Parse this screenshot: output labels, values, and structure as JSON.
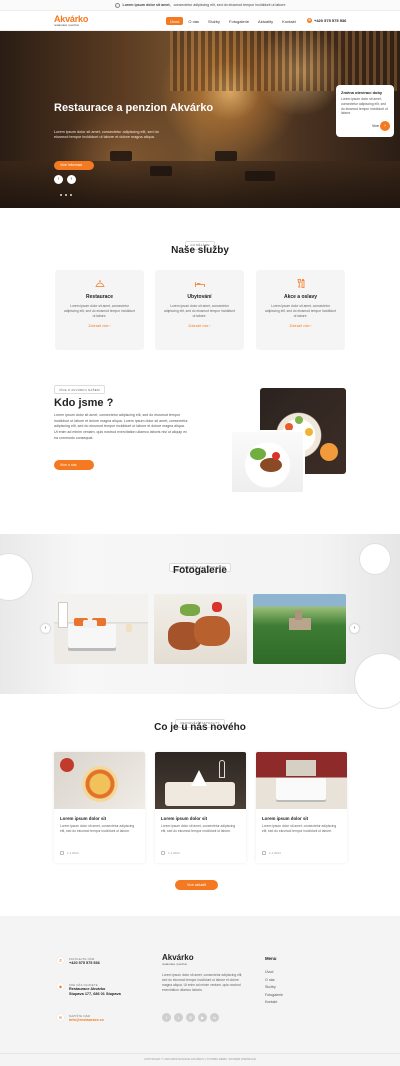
{
  "topbar": {
    "bold": "Lorem ipsum dolor sit amet,",
    "text": "consectetur adipiscing elit, sed do eiusmod tempor incididunt ut labore"
  },
  "nav": {
    "logo_name": "Akvárko",
    "logo_sub": "restaurace i penzion",
    "items": [
      "Úvod",
      "O nás",
      "Služby",
      "Fotogalerie",
      "Aktuality",
      "Kontakt"
    ],
    "phone": "+420 575 575 536"
  },
  "hero": {
    "title": "Restaurace a penzion Akvárko",
    "text": "Lorem ipsum dolor sit amet, consectetur adipiscing elit, sed do eiusmod tempor incididunt ut labore et dolore magna aliqua.",
    "button": "Více informací",
    "card": {
      "title": "Změna otevírací doby",
      "text": "Lorem ipsum dolor sit amet, consectetur adipiscing elit, sed do eiusmod tempor incididunt ut labore.",
      "more": "Více"
    }
  },
  "services": {
    "badge": "CO DĚLÁME",
    "title": "Naše služby",
    "items": [
      {
        "title": "Restaurace",
        "text": "Lorem ipsum dolor sit amet, consectetur adipiscing elit, sed do eiusmod tempor incididunt ut labore.",
        "link": "Zobrazit více"
      },
      {
        "title": "Ubytování",
        "text": "Lorem ipsum dolor sit amet, consectetur adipiscing elit, sed do eiusmod tempor incididunt ut labore.",
        "link": "Zobrazit více"
      },
      {
        "title": "Akce a oslavy",
        "text": "Lorem ipsum dolor sit amet, consectetur adipiscing elit, sed do eiusmod tempor incididunt ut labore.",
        "link": "Zobrazit více"
      }
    ]
  },
  "about": {
    "badge": "VÍCE O AKVÁRKU NAŠEM",
    "title": "Kdo jsme ?",
    "text": "Lorem ipsum dolor sit amet, consectetur adipiscing elit, sed do eiusmod tempor incididunt ut labore et dolore magna aliqua. Lorem ipsum dolor sit amet, consectetur adipiscing elit, sed do eiusmod tempor incididunt ut labore et dolore magna aliqua. Ut enim ad minim veniam, quis nostrud exercitation ullamco laboris nisi ut aliquip ex ea commodo consequat.",
    "button": "Více o nás"
  },
  "gallery": {
    "badge": "PROHLÉDNĚTE SI FOTOGALERII",
    "title": "Fotogalerie"
  },
  "news": {
    "badge": "NEJNOVĚJŠÍ AKTUALITY",
    "title": "Co je u nás nového",
    "items": [
      {
        "title": "Lorem ipsum dolor sit",
        "text": "Lorem ipsum dolor sit amet, consectetur adipiscing elit, sed do eiusmod tempor incididunt ut labore.",
        "date": "1.1.2024"
      },
      {
        "title": "Lorem ipsum dolor sit",
        "text": "Lorem ipsum dolor sit amet, consectetur adipiscing elit, sed do eiusmod tempor incididunt ut labore.",
        "date": "1.1.2024"
      },
      {
        "title": "Lorem ipsum dolor sit",
        "text": "Lorem ipsum dolor sit amet, consectetur adipiscing elit, sed do eiusmod tempor incididunt ut labore.",
        "date": "1.1.2024"
      }
    ],
    "button": "Více aktualit"
  },
  "footer": {
    "contacts": [
      {
        "label": "ZAVOLEJTE NÁM",
        "value": "+420 575 575 536",
        "icon": "phone-icon"
      },
      {
        "label": "KDE NÁS NAJDETE",
        "value": "Restaurace Akvárko",
        "value2": "Stupava 177, 686 01 Stupava",
        "icon": "location-icon"
      },
      {
        "label": "NAPIŠTE NÁM",
        "value": "info@restaurace.cz",
        "icon": "mail-icon"
      }
    ],
    "logo_name": "Akvárko",
    "logo_sub": "restaurace i penzion",
    "text": "Lorem ipsum dolor sit amet, consectetur adipiscing elit, sed do eiusmod tempor incididunt ut labore et dolore magna aliqua. Ut enim ad minim veniam, quis nostrud exercitation ullamco laboris.",
    "menu_title": "Menu",
    "menu": [
      "Úvod",
      "O nás",
      "Služby",
      "Fotogalerie",
      "Kontakt"
    ],
    "copyright": "COPYRIGHT © 2024 RESTAURACE AKVÁRKO | TVORBA WEBU: RIOWEB INSPIRACE"
  },
  "colors": {
    "accent": "#f47920"
  }
}
